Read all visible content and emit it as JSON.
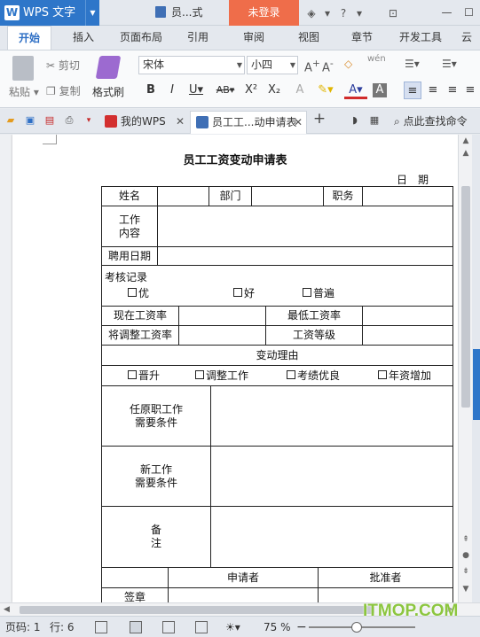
{
  "titlebar": {
    "app_name": "WPS 文字",
    "document_title": "员...式",
    "login_label": "未登录",
    "icons": [
      "skin-icon",
      "shirt-icon",
      "help-icon",
      "more-icon",
      "restore-icon",
      "minimize-icon",
      "maximize-icon"
    ]
  },
  "ribbon_tabs": [
    "开始",
    "插入",
    "页面布局",
    "引用",
    "审阅",
    "视图",
    "章节",
    "开发工具",
    "云"
  ],
  "ribbon": {
    "cut_label": "剪切",
    "copy_label": "复制",
    "paste_label": "粘贴",
    "format_painter_label": "格式刷",
    "font_name": "宋体",
    "font_size": "小四",
    "bold": "B",
    "italic": "I",
    "underline": "U",
    "strikethrough": "AB",
    "superscript": "X²",
    "subscript": "X₂",
    "pinyin_label": "wén"
  },
  "tabsbar": {
    "tabs": [
      {
        "label": "我的WPS",
        "active": false
      },
      {
        "label": "员工工...动申请表",
        "active": true
      }
    ],
    "add_label": "+",
    "search_label": "点此查找命令"
  },
  "form": {
    "title": "员工工资变动申请表",
    "date_label": "日期",
    "name_label": "姓名",
    "dept_label": "部门",
    "position_label": "职务",
    "work_content_label": "工作\n内容",
    "hire_date_label": "聘用日期",
    "assessment_label": "考核记录",
    "assessment_options": [
      "优",
      "好",
      "普遍"
    ],
    "current_wage_label": "现在工资率",
    "min_wage_label": "最低工资率",
    "adjusted_wage_label": "将调整工资率",
    "wage_grade_label": "工资等级",
    "reason_label": "变动理由",
    "reason_options": [
      "晋升",
      "调整工作",
      "考绩优良",
      "年资增加"
    ],
    "prev_job_label": "任原职工作\n需要条件",
    "new_job_label": "新工作\n需要条件",
    "remark_label": "备注",
    "applicant_label": "申请者",
    "approver_label": "批准者",
    "sign_label": "签章"
  },
  "statusbar": {
    "page_label": "页码: 1",
    "line_label": "行: 6",
    "zoom_label": "75 %",
    "zoom_level": 0.75
  },
  "watermark": "ITMOP.COM",
  "colors": {
    "accent": "#2e76c9",
    "login": "#ef6d4a",
    "watermark": "#8cc63f"
  }
}
